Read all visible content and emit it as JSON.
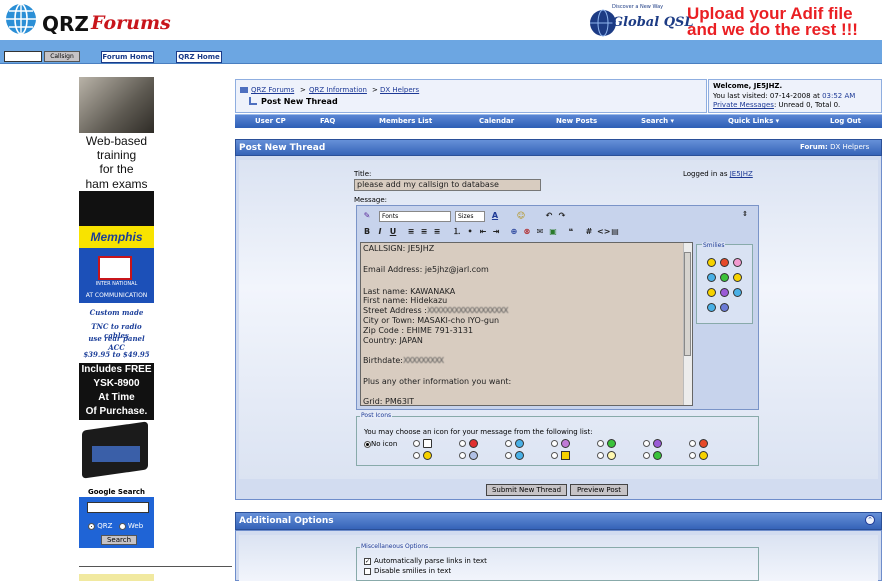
{
  "header": {
    "logo_qrz": "QRZ",
    "logo_forums": "Forums",
    "globalqsl_tagline": "Discover a New Way",
    "globalqsl_name": "Global QSL",
    "adif_line1": "Upload your Adif file",
    "adif_line2": "and we do the rest !!!"
  },
  "nav": {
    "callsign_button": "Callsign",
    "forum_home": "Forum Home",
    "qrz_home": "QRZ Home"
  },
  "sidebar": {
    "ad_training": [
      "Web-based",
      "training",
      "for the",
      "ham exams"
    ],
    "ad_memphis": "Memphis",
    "ad_inter_name": "INTER NATIONAL",
    "ad_atcomm": "AT COMMUNICATION",
    "ad_cable": [
      "Custom made",
      "TNC to radio cables",
      "use rear panel ACC",
      "$39.95 to $49.95"
    ],
    "ad_ysk": [
      "Includes FREE",
      "YSK-8900",
      "At Time",
      "Of Purchase."
    ],
    "google_search_title": "Google Search",
    "google_radio_qrz": "QRZ",
    "google_radio_web": "Web",
    "google_search_button": "Search"
  },
  "breadcrumb": {
    "items": [
      "QRZ Forums",
      "QRZ Information",
      "DX Helpers"
    ],
    "separator": ">",
    "current": "Post New Thread"
  },
  "welcome": {
    "welcome_text": "Welcome, JE5JHZ.",
    "last_visited_prefix": "You last visited: ",
    "last_visited_date": "07-14-2008",
    "last_visited_at": " at ",
    "last_visited_time": "03:52 AM",
    "pm_link": "Private Messages",
    "pm_status": ": Unread 0, Total 0."
  },
  "menu": [
    "User CP",
    "FAQ",
    "Members List",
    "Calendar",
    "New Posts",
    "Search ▾",
    "Quick Links ▾",
    "Log Out"
  ],
  "post_panel": {
    "title": "Post New Thread",
    "forum_prefix": "Forum:",
    "forum_name": "DX Helpers",
    "title_label": "Title:",
    "title_value": "please add my callsign to database",
    "logged_in_prefix": "Logged in as ",
    "logged_in_user": "JE5JHZ",
    "message_label": "Message:",
    "fonts_label": "Fonts",
    "sizes_label": "Sizes",
    "message_lines": [
      "CALLSIGN: JE5JHZ",
      "",
      "Email Address: je5jhz@jarl.com",
      "",
      "Last name: KAWANAKA",
      "First name: Hidekazu",
      "Street Address :",
      "City or Town: MASAKI-cho IYO-gun",
      "Zip Code : EHIME 791-3131",
      "Country: JAPAN",
      "",
      "Birthdate:",
      "",
      "Plus any other information you want:",
      "",
      "Grid: PM63IT"
    ],
    "blurred_street": "XXXXXXXXXXXXXXXXXX",
    "blurred_birth": "XXXXXXXXX",
    "smilies_label": "Smilies",
    "post_icons_label": "Post Icons",
    "post_icons_text": "You may choose an icon for your message from the following list:",
    "no_icon_label": "No icon",
    "submit_button": "Submit New Thread",
    "preview_button": "Preview Post"
  },
  "additional": {
    "title": "Additional Options",
    "collapse_icon": "collapse-icon",
    "misc_label": "Miscellaneous Options",
    "opt_parse_links": "Automatically parse links in text",
    "opt_disable_smilies": "Disable smilies in text"
  },
  "colors": {
    "accent_blue": "#3563b8",
    "nav_blue": "#6ca6e2",
    "logo_red": "#c8151b",
    "adif_red": "#ea1f23",
    "link_blue": "#1e3a96"
  }
}
